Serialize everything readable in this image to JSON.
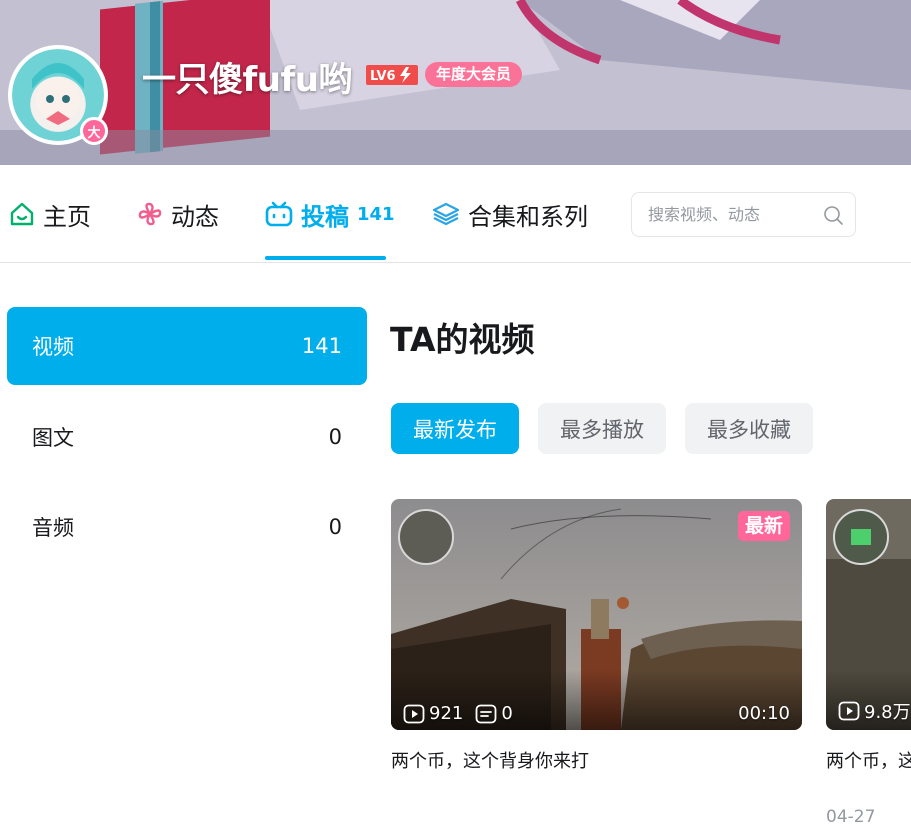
{
  "header": {
    "username": "一只傻fufu哟",
    "level_label": "LV6",
    "vip_label": "年度大会员",
    "avatar_badge": "大"
  },
  "nav": {
    "tabs": [
      {
        "label": "主页",
        "icon": "home-icon",
        "count": ""
      },
      {
        "label": "动态",
        "icon": "pinwheel-icon",
        "count": ""
      },
      {
        "label": "投稿",
        "icon": "tv-icon",
        "count": "141"
      },
      {
        "label": "合集和系列",
        "icon": "layers-icon",
        "count": ""
      }
    ],
    "active_tab": "投稿",
    "search_placeholder": "搜索视频、动态"
  },
  "sidebar": {
    "items": [
      {
        "label": "视频",
        "count": "141"
      },
      {
        "label": "图文",
        "count": "0"
      },
      {
        "label": "音频",
        "count": "0"
      }
    ]
  },
  "main": {
    "title": "TA的视频",
    "sort_buttons": [
      "最新发布",
      "最多播放",
      "最多收藏"
    ],
    "active_sort": "最新发布",
    "videos": [
      {
        "new_tag": "最新",
        "plays": "921",
        "comments": "0",
        "duration": "00:10",
        "title": "两个币，这个背身你来打",
        "date": ""
      },
      {
        "new_tag": "",
        "plays": "9.8万",
        "comments": "",
        "duration": "",
        "title": "两个币，这",
        "date": "04-27"
      }
    ]
  },
  "colors": {
    "accent": "#00aeec",
    "pink": "#ff6699",
    "text": "#18191c",
    "muted": "#9499a0"
  }
}
